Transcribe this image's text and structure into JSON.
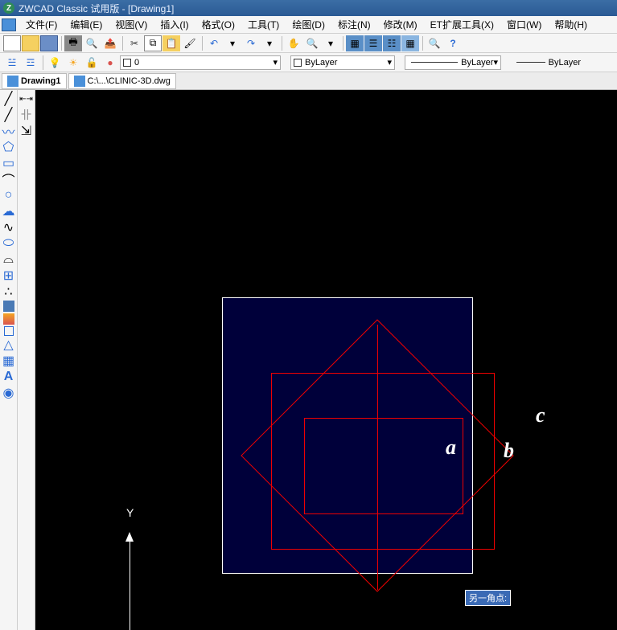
{
  "title": "ZWCAD Classic 试用版 - [Drawing1]",
  "menus": [
    "文件(F)",
    "编辑(E)",
    "视图(V)",
    "插入(I)",
    "格式(O)",
    "工具(T)",
    "绘图(D)",
    "标注(N)",
    "修改(M)",
    "ET扩展工具(X)",
    "窗口(W)",
    "帮助(H)"
  ],
  "combo_value": "0",
  "layer_dropdown": "ByLayer",
  "linetype_dropdown": "ByLayer",
  "lineweight_dropdown": "ByLayer",
  "tabs": [
    {
      "label": "Drawing1",
      "active": true
    },
    {
      "label": "C:\\...\\CLINIC-3D.dwg",
      "active": false
    }
  ],
  "annotations": {
    "a": "a",
    "b": "b",
    "c": "c"
  },
  "ucs_label": "Y",
  "tooltip": "另一角点:",
  "left_tools": [
    "line",
    "construction-line",
    "polyline",
    "polygon",
    "rectangle",
    "arc",
    "circle",
    "revision-cloud",
    "spline",
    "ellipse",
    "ellipse-arc",
    "insert-block",
    "point",
    "hatch",
    "gradient",
    "region",
    "table",
    "text",
    "mtext",
    "pyramid"
  ],
  "left_tools2": [
    "dim-linear",
    "dim-continue",
    "dim-align"
  ]
}
